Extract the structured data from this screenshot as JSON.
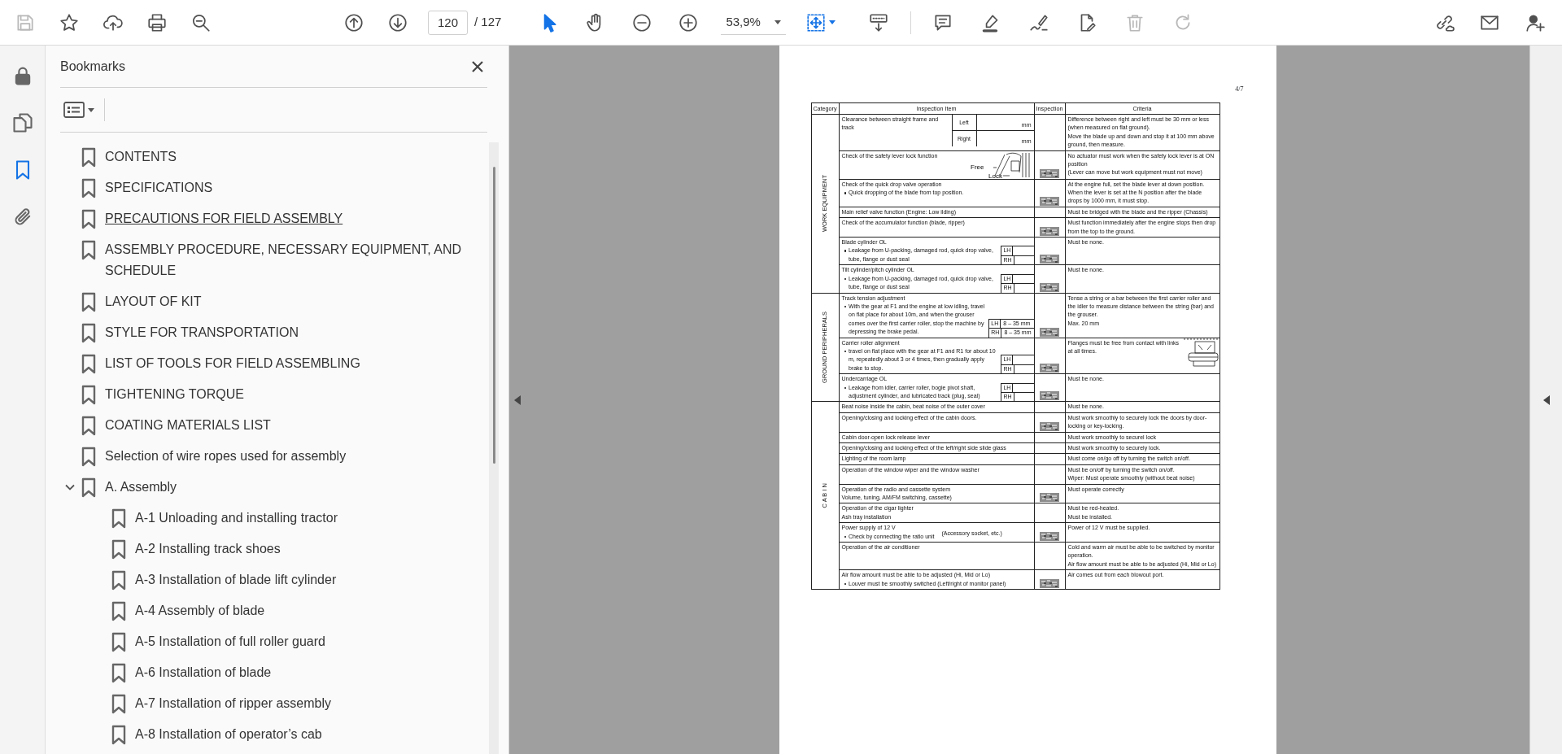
{
  "toolbar": {
    "file_tools": [
      {
        "kind": "save",
        "disabled": true
      },
      {
        "kind": "star",
        "disabled": false
      },
      {
        "kind": "upload",
        "disabled": false
      },
      {
        "kind": "print",
        "disabled": false
      },
      {
        "kind": "search",
        "disabled": false
      }
    ],
    "page_nav": [
      {
        "kind": "up"
      },
      {
        "kind": "down"
      }
    ],
    "page_number": "120",
    "page_total": "/ 127",
    "view_tools": [
      {
        "kind": "select",
        "selected": true
      },
      {
        "kind": "hand",
        "selected": false
      },
      {
        "kind": "zoom-out",
        "selected": false
      },
      {
        "kind": "zoom-in",
        "selected": false
      }
    ],
    "zoom": "53,9%",
    "layout_tools": [
      {
        "kind": "fit",
        "menu": true
      },
      {
        "kind": "read",
        "menu": false
      }
    ],
    "edit_tools": [
      {
        "kind": "comment",
        "disabled": false
      },
      {
        "kind": "highlight",
        "disabled": false
      },
      {
        "kind": "sign",
        "disabled": false
      },
      {
        "kind": "edit",
        "disabled": false
      },
      {
        "kind": "trash",
        "disabled": true
      },
      {
        "kind": "redo",
        "disabled": true
      }
    ],
    "share_tools": [
      {
        "kind": "link"
      },
      {
        "kind": "mail"
      },
      {
        "kind": "user"
      }
    ]
  },
  "rail": [
    {
      "kind": "lock",
      "selected": false
    },
    {
      "kind": "pages",
      "selected": false
    },
    {
      "kind": "bookmark",
      "selected": true
    },
    {
      "kind": "clip",
      "selected": false
    }
  ],
  "bookmarks": {
    "title": "Bookmarks",
    "items": [
      {
        "label": "CONTENTS",
        "hovered": false
      },
      {
        "label": "SPECIFICATIONS",
        "hovered": false
      },
      {
        "label": "PRECAUTIONS FOR FIELD ASSEMBLY",
        "hovered": true
      },
      {
        "label": "ASSEMBLY PROCEDURE, NECESSARY EQUIPMENT, AND SCHEDULE",
        "hovered": false
      },
      {
        "label": "LAYOUT OF KIT",
        "hovered": false
      },
      {
        "label": "STYLE FOR TRANSPORTATION",
        "hovered": false
      },
      {
        "label": "LIST OF TOOLS FOR FIELD ASSEMBLING",
        "hovered": false
      },
      {
        "label": "TIGHTENING TORQUE",
        "hovered": false
      },
      {
        "label": "COATING MATERIALS LIST",
        "hovered": false
      },
      {
        "label": "Selection of wire ropes used for assembly",
        "hovered": false
      },
      {
        "label": "A. Assembly",
        "hovered": false,
        "expanded": true,
        "children": [
          {
            "label": "A-1 Unloading and installing tractor",
            "hovered": false
          },
          {
            "label": "A-2 Installing track shoes",
            "hovered": false
          },
          {
            "label": "A-3 Installation of blade lift cylinder",
            "hovered": false
          },
          {
            "label": "A-4 Assembly of blade",
            "hovered": false
          },
          {
            "label": "A-5 Installation of full roller guard",
            "hovered": false
          },
          {
            "label": "A-6 Installation of blade",
            "hovered": false
          },
          {
            "label": "A-7 Installation of ripper assembly",
            "hovered": false
          },
          {
            "label": "A-8 Installation of operator’s cab",
            "hovered": false
          }
        ]
      }
    ]
  },
  "document": {
    "page_label": "4/7",
    "columns": [
      "Category",
      "Inspection Item",
      "Inspection",
      "Criteria"
    ],
    "categories": [
      {
        "name": "WORK EQUIPMENT",
        "rows": [
          {
            "lines": [
              "Clearance between straight frame and track"
            ],
            "sides": [
              {
                "label": "Left",
                "unit": "mm"
              },
              {
                "label": "Right",
                "unit": "mm"
              }
            ],
            "inspected": false,
            "criteria": [
              "Difference between right and left must be 30 mm or less (when measured on flat ground).",
              "Move the blade up and down and stop it at 100 mm above ground, then measure."
            ]
          },
          {
            "lines": [
              "Check of the safety lever lock function"
            ],
            "figure": {
              "kind": "lever",
              "labels": [
                "Free",
                "Lock"
              ]
            },
            "inspected": true,
            "criteria": [
              "No actuator must work when the safety lock lever is at ON position",
              "(Lever can move but work equipment must not move)"
            ]
          },
          {
            "lines": [
              "Check of the quick drop valve operation"
            ],
            "bullet": "Quick dropping of the blade from top position.",
            "inspected": true,
            "criteria": [
              "At the engine full, set the blade lever at down position.  When the lever is set at the N position after the blade drops by 1000 mm, it must stop."
            ]
          },
          {
            "lines": [
              "Main relief valve function (Engine: Low ilding)"
            ],
            "inspected": false,
            "criteria": [
              "Must be bridged with the blade and the ripper (Chassis)"
            ]
          },
          {
            "lines": [
              "Check of the accumulator function (blade, ripper)"
            ],
            "inspected": true,
            "criteria": [
              "Must function immediately after the engine stops then drop from the top to the ground."
            ]
          },
          {
            "lines": [
              "Blade cylinder OL"
            ],
            "bullet": "Leakage from U-packing, damaged rod, quick drop valve, tube, flange or dust seal",
            "sides": [
              {
                "label": "LH"
              },
              {
                "label": "RH"
              }
            ],
            "inspected": true,
            "criteria": [
              "Must be none."
            ]
          },
          {
            "lines": [
              "Tilt cylinder/pitch cylinder OL"
            ],
            "bullet": "Leakage from U-packing, damaged rod, quick drop valve, tube, flange or dust seal",
            "sides": [
              {
                "label": "LH"
              },
              {
                "label": "RH"
              }
            ],
            "inspected": true,
            "criteria": [
              "Must be none."
            ]
          }
        ]
      },
      {
        "name": "GROUND PERIPHERALS",
        "rows": [
          {
            "lines": [
              "Track tension adjustment"
            ],
            "bullet": "With the gear at F1 and the engine at low idling, travel on flat place for about 10m, and when the grouser comes over the first carrier roller, stop the machine by depressing the brake pedal.",
            "sides": [
              {
                "label": "LH",
                "value": "8 – 35 mm"
              },
              {
                "label": "RH",
                "value": "8 – 35 mm"
              }
            ],
            "inspected": true,
            "criteria": [
              "Tense a string or a bar between the first carrier roller and the idler to measure distance between the string (bar) and the grouser.",
              "Max. 20 mm"
            ]
          },
          {
            "lines": [
              "Carrier roller alignment"
            ],
            "bullet": "travel on flat place with the gear at F1 and R1 for about 10 m, repeatedly about 3 or 4 times, then gradually apply brake to stop.",
            "sides": [
              {
                "label": "LH"
              },
              {
                "label": "RH"
              }
            ],
            "inspected": true,
            "figure": {
              "kind": "roller"
            },
            "criteria": [
              "Flanges must be free from contact with links at all times."
            ]
          },
          {
            "lines": [
              "Undercarriage OL"
            ],
            "bullet": "Leakage from idler, carrier roller, bogie pivot shaft, adjustment cylinder, and lubricated track (plug, seal)",
            "sides": [
              {
                "label": "LH"
              },
              {
                "label": "RH"
              }
            ],
            "inspected": true,
            "criteria": [
              "Must be none."
            ]
          }
        ]
      },
      {
        "name": "C A B I N",
        "rows": [
          {
            "lines": [
              "Beat noise inside the cabin, beat noise of the outer cover"
            ],
            "inspected": false,
            "criteria": [
              "Must be none."
            ]
          },
          {
            "lines": [
              "Opening/closing and locking effect of the cabin doors."
            ],
            "inspected": true,
            "criteria": [
              "Must work smoothly to securely lock the doors by door-locking or key-locking."
            ]
          },
          {
            "lines": [
              "Cabin door-open lock release lever"
            ],
            "inspected": false,
            "criteria": [
              "Must work smoothly to securel lock"
            ]
          },
          {
            "lines": [
              "Opening/closing and locking effect of the left/right side slide glass"
            ],
            "inspected": false,
            "criteria": [
              "Must work smoothly to securely lock."
            ]
          },
          {
            "lines": [
              "Lighting of the room lamp"
            ],
            "inspected": false,
            "criteria": [
              "Must come on/go off by turning the switch on/off."
            ]
          },
          {
            "lines": [
              "Operation of the window wiper and the window washer"
            ],
            "inspected": false,
            "criteria": [
              "Must be on/off by turning the switch on/off.",
              "Wiper:  Must operate smoothly (without beat noise)"
            ]
          },
          {
            "lines": [
              "Operation of the radio and cassette system",
              "Volume, tuning, AM/FM switching, cassette)"
            ],
            "inspected": true,
            "criteria": [
              "Must operate correctly"
            ]
          },
          {
            "lines": [
              "Operation of the cigar lighter",
              "Ash tray installation"
            ],
            "inspected": false,
            "criteria": [
              "Must be red-heated.",
              "Must be installed."
            ]
          },
          {
            "lines": [
              "Power supply of 12 V"
            ],
            "bullet": "Check by connecting the ratio unit",
            "note": "(Accessory socket, etc.)",
            "inspected": true,
            "criteria": [
              "Power of 12 V must be supplied."
            ]
          },
          {
            "lines": [
              "Operation of the air conditioner"
            ],
            "inspected": false,
            "criteria": [
              "Cold and warm air must be able to be switched by monitor operation.",
              "Air flow amount must be able to be adjusted (Hi, Mid or Lo)"
            ]
          },
          {
            "lines": [
              "Air flow amount must be able to be adjusted (Hi, Mid or Lo)"
            ],
            "bullet": "Louver must be smoothly switched (Left/right of monitor panel)",
            "inspected": true,
            "criteria": [
              "Air comes out from each blowout port."
            ]
          }
        ]
      }
    ]
  }
}
